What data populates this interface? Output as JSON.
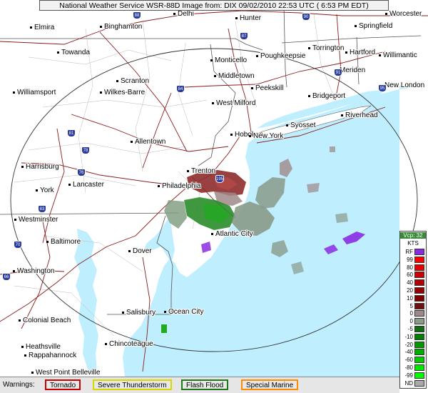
{
  "header": {
    "title": "National Weather Service WSR-88D Image  from:  DIX 09/02/2010  22:53 UTC  ( 6:53 PM EDT)"
  },
  "map": {
    "cities": [
      {
        "id": "elmira",
        "name": "Elmira"
      },
      {
        "id": "binghamton",
        "name": "Binghamton"
      },
      {
        "id": "delhi",
        "name": "Delhi"
      },
      {
        "id": "hunter",
        "name": "Hunter"
      },
      {
        "id": "worcester",
        "name": "Worcester"
      },
      {
        "id": "springfield",
        "name": "Springfield"
      },
      {
        "id": "towanda",
        "name": "Towanda"
      },
      {
        "id": "monticello",
        "name": "Monticello"
      },
      {
        "id": "poughkeepsie",
        "name": "Poughkeepsie"
      },
      {
        "id": "torrington",
        "name": "Torrington"
      },
      {
        "id": "hartford",
        "name": "Hartford"
      },
      {
        "id": "willimantic",
        "name": "Willimantic"
      },
      {
        "id": "meriden",
        "name": "Meriden"
      },
      {
        "id": "middletown",
        "name": "Middletown"
      },
      {
        "id": "scranton",
        "name": "Scranton"
      },
      {
        "id": "peekskill",
        "name": "Peekskill"
      },
      {
        "id": "newlondon",
        "name": "New London"
      },
      {
        "id": "williamsport",
        "name": "Williamsport"
      },
      {
        "id": "wilkesbarre",
        "name": "Wilkes-Barre"
      },
      {
        "id": "bridgeport",
        "name": "Bridgeport"
      },
      {
        "id": "westmilford",
        "name": "West Milford"
      },
      {
        "id": "riverhead",
        "name": "Riverhead"
      },
      {
        "id": "syosset",
        "name": "Syosset"
      },
      {
        "id": "hoboken",
        "name": "Hoboken"
      },
      {
        "id": "newyork",
        "name": "New York"
      },
      {
        "id": "allentown",
        "name": "Allentown"
      },
      {
        "id": "harrisburg",
        "name": "Harrisburg"
      },
      {
        "id": "trenton",
        "name": "Trenton"
      },
      {
        "id": "lancaster",
        "name": "Lancaster"
      },
      {
        "id": "philadelphia",
        "name": "Philadelphia"
      },
      {
        "id": "york",
        "name": "York"
      },
      {
        "id": "westminster",
        "name": "Westminster"
      },
      {
        "id": "atlanticcity",
        "name": "Atlantic City"
      },
      {
        "id": "baltimore",
        "name": "Baltimore"
      },
      {
        "id": "dover",
        "name": "Dover"
      },
      {
        "id": "washington",
        "name": "Washington"
      },
      {
        "id": "salisbury",
        "name": "Salisbury"
      },
      {
        "id": "oceancity",
        "name": "Ocean City"
      },
      {
        "id": "colonialbeach",
        "name": "Colonial Beach"
      },
      {
        "id": "chincoteague",
        "name": "Chincoteague"
      },
      {
        "id": "heathsville",
        "name": "Heathsville"
      },
      {
        "id": "rappahannock",
        "name": "Rappahannock"
      },
      {
        "id": "westpointbelleville",
        "name": "West Point Belleville"
      }
    ],
    "interstates": [
      {
        "id": "i88",
        "num": "88"
      },
      {
        "id": "i87",
        "num": "87"
      },
      {
        "id": "i90",
        "num": "90"
      },
      {
        "id": "i91",
        "num": "91"
      },
      {
        "id": "i84",
        "num": "84"
      },
      {
        "id": "i95",
        "num": "95"
      },
      {
        "id": "i78",
        "num": "78"
      },
      {
        "id": "i81",
        "num": "81"
      },
      {
        "id": "i76",
        "num": "76"
      },
      {
        "id": "i83",
        "num": "83"
      },
      {
        "id": "i70",
        "num": "70"
      },
      {
        "id": "i195",
        "num": "195"
      },
      {
        "id": "i66",
        "num": "66"
      }
    ],
    "colors": {
      "water": "#bfeeff",
      "land": "#ffffff",
      "range_ring": "#333333",
      "roads": "#8b1a1a",
      "borders": "#555555"
    }
  },
  "legend": {
    "product": "Vcp: 32",
    "units": "KTS",
    "items": [
      {
        "label": "RF",
        "color": "#8a2be2"
      },
      {
        "label": "99",
        "color": "#ff0000"
      },
      {
        "label": "80",
        "color": "#e60000"
      },
      {
        "label": "60",
        "color": "#cc0000"
      },
      {
        "label": "40",
        "color": "#b00000"
      },
      {
        "label": "20",
        "color": "#990000"
      },
      {
        "label": "10",
        "color": "#800000"
      },
      {
        "label": "5",
        "color": "#6e1010"
      },
      {
        "label": "0",
        "color": "#a08888"
      },
      {
        "label": "0",
        "color": "#889c88"
      },
      {
        "label": "-5",
        "color": "#106e10"
      },
      {
        "label": "-10",
        "color": "#008000"
      },
      {
        "label": "-20",
        "color": "#009900"
      },
      {
        "label": "-40",
        "color": "#00b000"
      },
      {
        "label": "-60",
        "color": "#00cc00"
      },
      {
        "label": "-80",
        "color": "#00e600"
      },
      {
        "label": "-99",
        "color": "#00ff00"
      },
      {
        "label": "ND",
        "color": "#a9a9a9"
      }
    ]
  },
  "warnings": {
    "label": "Warnings:",
    "items": [
      {
        "id": "tornado",
        "label": "Tornado",
        "color": "#cc0000"
      },
      {
        "id": "severe-thunderstorm",
        "label": "Severe Thunderstorm",
        "color": "#d8d800"
      },
      {
        "id": "flash-flood",
        "label": "Flash Flood",
        "color": "#1a7a1a"
      },
      {
        "id": "special-marine",
        "label": "Special Marine",
        "color": "#ff8c00"
      }
    ]
  }
}
